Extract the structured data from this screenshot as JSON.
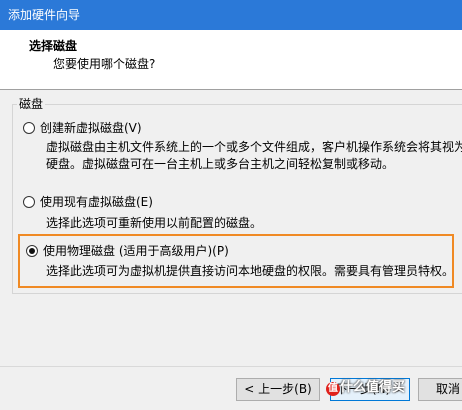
{
  "window": {
    "title": "添加硬件向导"
  },
  "header": {
    "title": "选择磁盘",
    "subtitle": "您要使用哪个磁盘?"
  },
  "group": {
    "label": "磁盘"
  },
  "options": [
    {
      "label": "创建新虚拟磁盘(V)",
      "desc_line1": "虚拟磁盘由主机文件系统上的一个或多个文件组成，客户机操作系统会将其视为",
      "desc_line2": "硬盘。虚拟磁盘可在一台主机上或多台主机之间轻松复制或移动。",
      "selected": false
    },
    {
      "label": "使用现有虚拟磁盘(E)",
      "desc_line1": "选择此选项可重新使用以前配置的磁盘。",
      "selected": false
    },
    {
      "label": "使用物理磁盘 (适用于高级用户)(P)",
      "desc_line1": "选择此选项可为虚拟机提供直接访问本地硬盘的权限。需要具有管理员特权。",
      "selected": true
    }
  ],
  "buttons": {
    "back": "< 上一步(B)",
    "next": "下一步(N) >",
    "cancel": "取消"
  },
  "watermark": {
    "badge": "值",
    "text": "什么值得买"
  },
  "colors": {
    "titlebar": "#2b79d8",
    "highlight": "#f08a24"
  }
}
